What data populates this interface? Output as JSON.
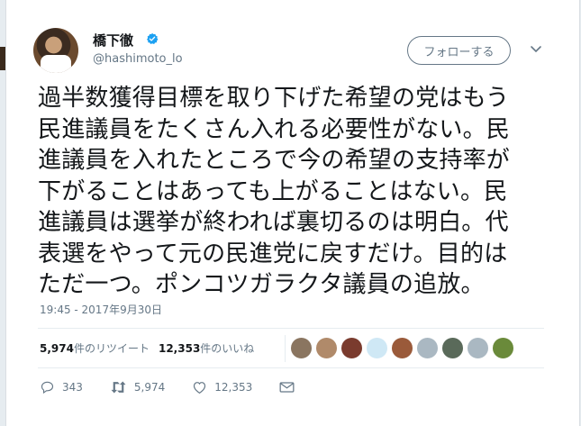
{
  "profile": {
    "name": "橋下徹",
    "handle": "@hashimoto_lo",
    "follow_label": "フォローする"
  },
  "tweet": {
    "text": "過半数獲得目標を取り下げた希望の党はもう\n民進議員をたくさん入れる必要性がない。民\n進議員を入れたところで今の希望の支持率が\n下がることはあっても上がることはない。民\n進議員は選挙が終われば裏切るのは明白。代\n表選をやって元の民進党に戻すだけ。目的は\nただ一つ。ポンコツガラクタ議員の追放。",
    "timestamp": "19:45 - 2017年9月30日"
  },
  "stats": {
    "retweet_count": "5,974",
    "retweet_label": "件のリツイート",
    "like_count": "12,353",
    "like_label": "件のいいね"
  },
  "liker_avatars": [
    {
      "name": "avatar-1",
      "color": "#8a7560"
    },
    {
      "name": "avatar-2",
      "color": "#b08a6a"
    },
    {
      "name": "avatar-3",
      "color": "#7a3b2e"
    },
    {
      "name": "avatar-4",
      "color": "#cfe8f5"
    },
    {
      "name": "avatar-5",
      "color": "#9a5a3a"
    },
    {
      "name": "avatar-6",
      "color": "#aab8c2"
    },
    {
      "name": "avatar-7",
      "color": "#5a6a5a"
    },
    {
      "name": "avatar-8",
      "color": "#aab8c2"
    },
    {
      "name": "avatar-9",
      "color": "#6a8a3a"
    }
  ],
  "actions": {
    "reply_count": "343",
    "retweet_count": "5,974",
    "like_count": "12,353"
  },
  "icons": [
    "verified-badge-icon",
    "chevron-down-icon",
    "reply-icon",
    "retweet-icon",
    "heart-icon",
    "mail-icon"
  ],
  "colors": {
    "verified": "#1da1f2",
    "secondary_text": "#657786",
    "primary_text": "#14171a"
  }
}
